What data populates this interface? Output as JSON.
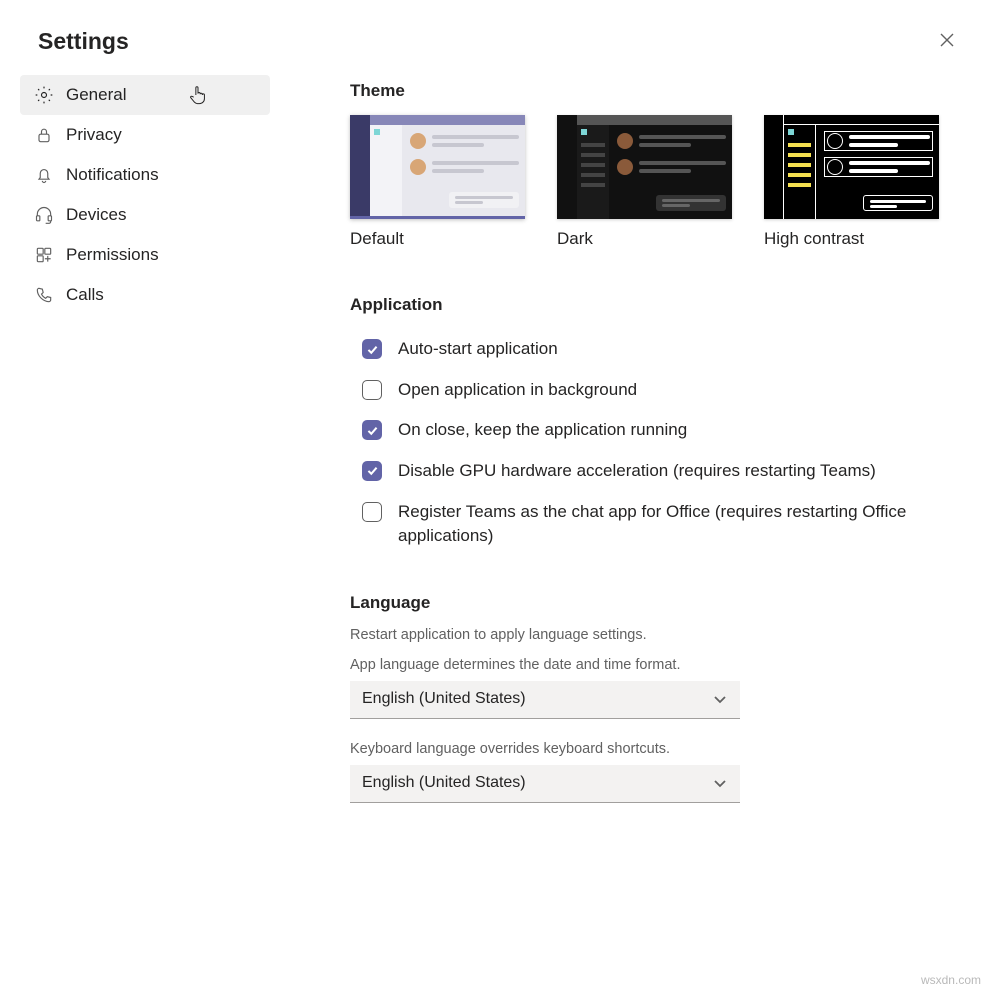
{
  "header": {
    "title": "Settings"
  },
  "sidebar": {
    "items": [
      {
        "label": "General"
      },
      {
        "label": "Privacy"
      },
      {
        "label": "Notifications"
      },
      {
        "label": "Devices"
      },
      {
        "label": "Permissions"
      },
      {
        "label": "Calls"
      }
    ]
  },
  "theme": {
    "title": "Theme",
    "options": [
      {
        "label": "Default"
      },
      {
        "label": "Dark"
      },
      {
        "label": "High contrast"
      }
    ]
  },
  "application": {
    "title": "Application",
    "options": [
      {
        "label": "Auto-start application",
        "checked": true
      },
      {
        "label": "Open application in background",
        "checked": false
      },
      {
        "label": "On close, keep the application running",
        "checked": true
      },
      {
        "label": "Disable GPU hardware acceleration (requires restarting Teams)",
        "checked": true
      },
      {
        "label": "Register Teams as the chat app for Office (requires restarting Office applications)",
        "checked": false
      }
    ]
  },
  "language": {
    "title": "Language",
    "hint": "Restart application to apply language settings.",
    "app_label": "App language determines the date and time format.",
    "app_value": "English (United States)",
    "kb_label": "Keyboard language overrides keyboard shortcuts.",
    "kb_value": "English (United States)"
  },
  "watermark": "wsxdn.com"
}
